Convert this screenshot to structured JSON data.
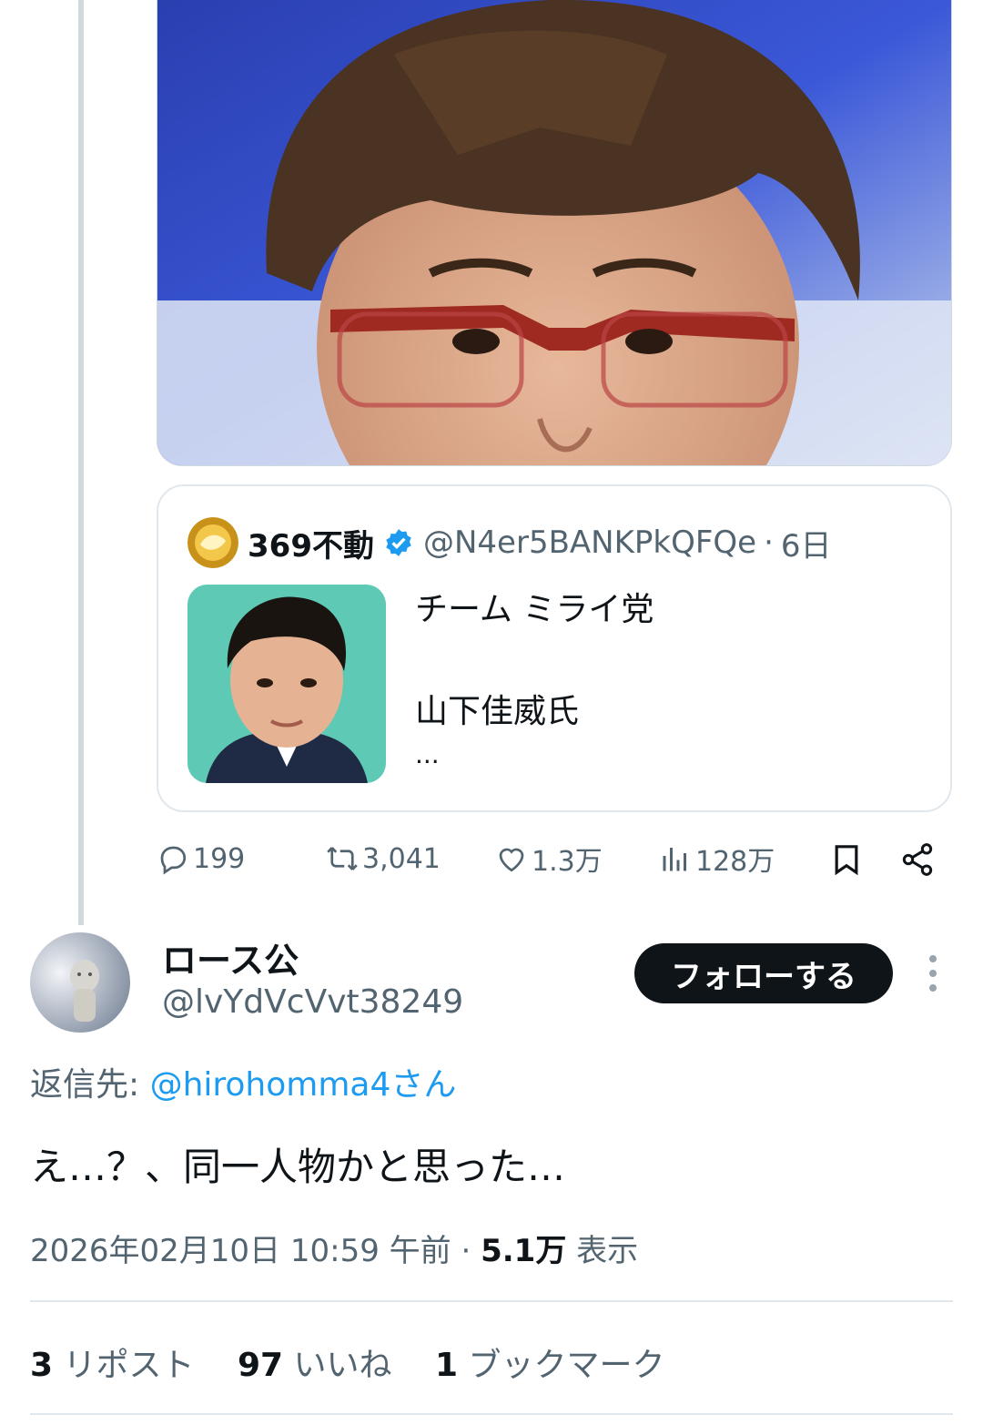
{
  "quoted_tweet": {
    "name": "369不動",
    "handle": "@N4er5BANKPkQFQe",
    "separator": "·",
    "age": "6日",
    "lines": [
      "チーム ミライ党",
      "山下佳威氏",
      "..."
    ]
  },
  "actions": {
    "replies": "199",
    "reposts": "3,041",
    "likes": "1.3万",
    "views": "128万"
  },
  "author": {
    "name": "ロース公",
    "handle": "@lvYdVcVvt38249",
    "follow_label": "フォローする"
  },
  "reply_to": {
    "prefix": "返信先: ",
    "target": "@hirohomma4さん"
  },
  "tweet_text": "え…？、同一人物かと思った…",
  "meta": {
    "timestamp": "2026年02月10日 10:59 午前",
    "separator": " · ",
    "views_count": "5.1万",
    "views_label": " 表示"
  },
  "stats": {
    "reposts_count": "3",
    "reposts_label": " リポスト",
    "likes_count": "97",
    "likes_label": " いいね",
    "bookmarks_count": "1",
    "bookmarks_label": " ブックマーク"
  },
  "colors": {
    "accent": "#1d9bf0",
    "text": "#0f1419",
    "muted": "#536471",
    "border": "#cfd9de"
  },
  "icons": [
    "reply-icon",
    "repost-icon",
    "like-icon",
    "views-icon",
    "bookmark-icon",
    "share-icon",
    "verified-icon",
    "more-icon"
  ]
}
